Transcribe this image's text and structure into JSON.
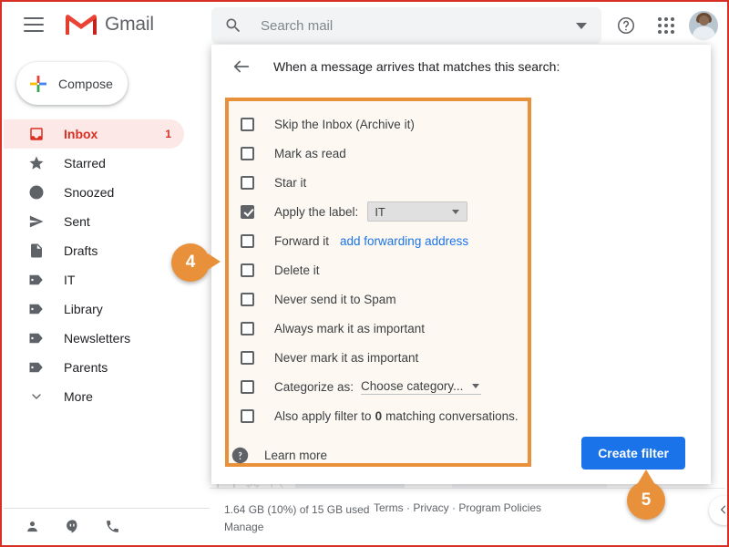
{
  "app": {
    "brand": "Gmail",
    "accent_blue": "#1a73e8",
    "accent_red": "#d93025",
    "callout_orange": "#e8913a"
  },
  "topbar": {
    "menu_icon": "hamburger-icon",
    "logo_icon": "gmail-logo-icon",
    "help_icon": "help-icon",
    "apps_icon": "apps-grid-icon",
    "avatar_icon": "user-avatar"
  },
  "search": {
    "icon": "search-icon",
    "value": "",
    "placeholder": "Search mail",
    "options_icon": "chevron-down-icon"
  },
  "sidebar": {
    "compose_label": "Compose",
    "compose_icon": "plus-icon",
    "items": [
      {
        "label": "Inbox",
        "icon": "inbox-icon",
        "count": "1",
        "active": true
      },
      {
        "label": "Starred",
        "icon": "star-icon",
        "count": "",
        "active": false
      },
      {
        "label": "Snoozed",
        "icon": "clock-icon",
        "count": "",
        "active": false
      },
      {
        "label": "Sent",
        "icon": "send-icon",
        "count": "",
        "active": false
      },
      {
        "label": "Drafts",
        "icon": "draft-icon",
        "count": "",
        "active": false
      },
      {
        "label": "IT",
        "icon": "label-icon",
        "count": "",
        "active": false
      },
      {
        "label": "Library",
        "icon": "label-icon",
        "count": "",
        "active": false
      },
      {
        "label": "Newsletters",
        "icon": "label-icon",
        "count": "",
        "active": false
      },
      {
        "label": "Parents",
        "icon": "label-icon",
        "count": "",
        "active": false
      },
      {
        "label": "More",
        "icon": "chevron-down-icon",
        "count": "",
        "active": false
      }
    ],
    "bottom_icons": [
      "contacts-icon",
      "hangouts-icon",
      "phone-icon"
    ]
  },
  "dialog": {
    "back_icon": "back-arrow-icon",
    "title": "When a message arrives that matches this search:",
    "options": [
      {
        "label": "Skip the Inbox (Archive it)",
        "checked": false,
        "control": "none"
      },
      {
        "label": "Mark as read",
        "checked": false,
        "control": "none"
      },
      {
        "label": "Star it",
        "checked": false,
        "control": "none"
      },
      {
        "label": "Apply the label:",
        "checked": true,
        "control": "select",
        "select_value": "IT"
      },
      {
        "label": "Forward it",
        "checked": false,
        "control": "link",
        "link_text": "add forwarding address"
      },
      {
        "label": "Delete it",
        "checked": false,
        "control": "none"
      },
      {
        "label": "Never send it to Spam",
        "checked": false,
        "control": "none"
      },
      {
        "label": "Always mark it as important",
        "checked": false,
        "control": "none"
      },
      {
        "label": "Never mark it as important",
        "checked": false,
        "control": "none"
      },
      {
        "label": "Categorize as:",
        "checked": false,
        "control": "category",
        "select_value": "Choose category..."
      },
      {
        "label": "Also apply filter to",
        "checked": false,
        "control": "count",
        "count_value": "0",
        "label_tail": "matching conversations."
      }
    ],
    "learn_more_label": "Learn more",
    "learn_more_icon": "help-icon",
    "create_filter_label": "Create filter"
  },
  "footer": {
    "storage_line1": "1.64 GB (10%) of 15 GB used",
    "storage_line2": "Manage",
    "links": "Terms · Privacy · Program Policies",
    "collapse_icon": "chevron-left-icon"
  },
  "callouts": [
    {
      "number": "4"
    },
    {
      "number": "5"
    }
  ]
}
